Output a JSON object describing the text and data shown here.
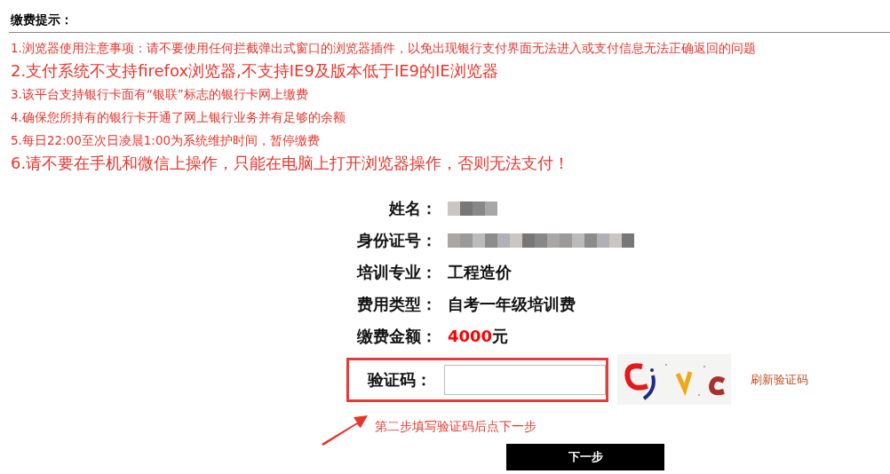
{
  "notice": {
    "title": "缴费提示：",
    "items": [
      {
        "kind": "small",
        "text": "1.浏览器使用注意事项：请不要使用任何拦截弹出式窗口的浏览器插件，以免出现银行支付界面无法进入或支付信息无法正确返回的问题"
      },
      {
        "kind": "large",
        "text": "2.支付系统不支持firefox浏览器,不支持IE9及版本低于IE9的IE浏览器"
      },
      {
        "kind": "small",
        "text": "3.该平台支持银行卡面有“银联”标志的银行卡网上缴费"
      },
      {
        "kind": "small",
        "text": "4.确保您所持有的银行卡开通了网上银行业务并有足够的余额"
      },
      {
        "kind": "small",
        "text": "5.每日22:00至次日凌晨1:00为系统维护时间，暂停缴费"
      },
      {
        "kind": "large",
        "text": "6.请不要在手机和微信上操作，只能在电脑上打开浏览器操作，否则无法支付！"
      }
    ]
  },
  "form": {
    "rows": [
      {
        "kind": "redacted",
        "label": "姓名："
      },
      {
        "kind": "redacted",
        "label": "身份证号："
      },
      {
        "kind": "text",
        "label": "培训专业：",
        "value": "工程造价"
      },
      {
        "kind": "text",
        "label": "费用类型：",
        "value": "自考一年级培训费"
      },
      {
        "kind": "amount",
        "label": "缴费金额：",
        "value": "4000",
        "unit": "元"
      }
    ],
    "captcha": {
      "label": "验证码：",
      "refresh": "刷新验证码"
    },
    "hint": "第二步填写验证码后点下一步",
    "submit": "下一步"
  }
}
